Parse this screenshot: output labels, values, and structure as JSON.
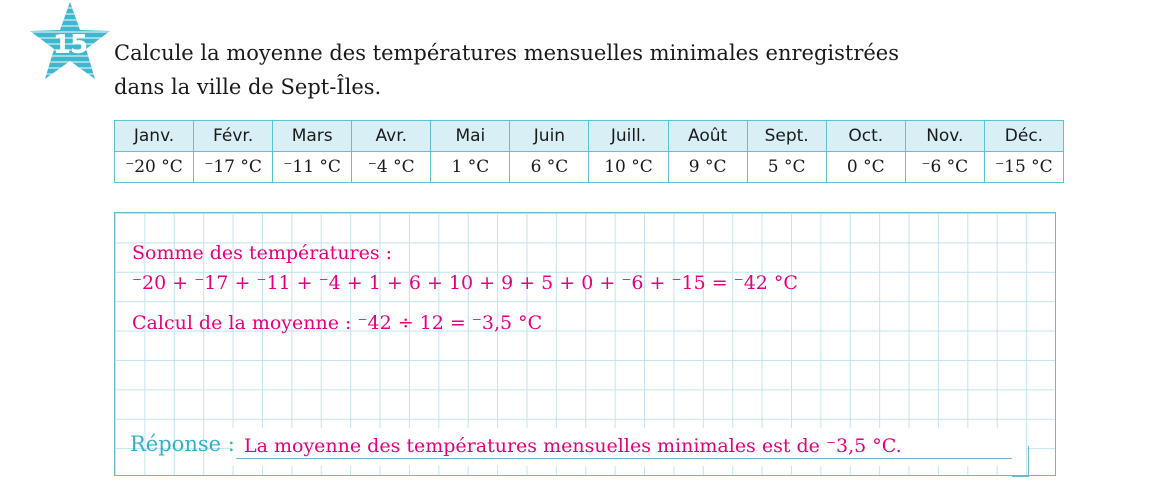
{
  "exercise": {
    "number": "15",
    "question_lines": [
      "Calcule la moyenne des températures mensuelles minimales enregistrées",
      "dans la ville de Sept-Îles."
    ]
  },
  "table": {
    "months": [
      "Janv.",
      "Févr.",
      "Mars",
      "Avr.",
      "Mai",
      "Juin",
      "Juill.",
      "Août",
      "Sept.",
      "Oct.",
      "Nov.",
      "Déc."
    ],
    "temperatures": [
      "⁻20 °C",
      "⁻17 °C",
      "⁻11 °C",
      "⁻4 °C",
      "1 °C",
      "6 °C",
      "10 °C",
      "9 °C",
      "5 °C",
      "0 °C",
      "⁻6 °C",
      "⁻15 °C"
    ]
  },
  "solution": {
    "sum_label": "Somme des températures :",
    "sum_expression": "⁻20 + ⁻17 + ⁻11 + ⁻4 + 1 + 6 + 10 + 9 + 5 + 0 + ⁻6 + ⁻15 = ⁻42 °C",
    "mean_line": "Calcul de la moyenne : ⁻42 ÷ 12 = ⁻3,5 °C"
  },
  "answer": {
    "label": "Réponse :",
    "text": "La moyenne des températures mensuelles minimales est de ⁻3,5 °C."
  },
  "colors": {
    "accent_cyan": "#2fb2c9",
    "handwriting_magenta": "#e6007e",
    "header_bg": "#d8eff5"
  }
}
